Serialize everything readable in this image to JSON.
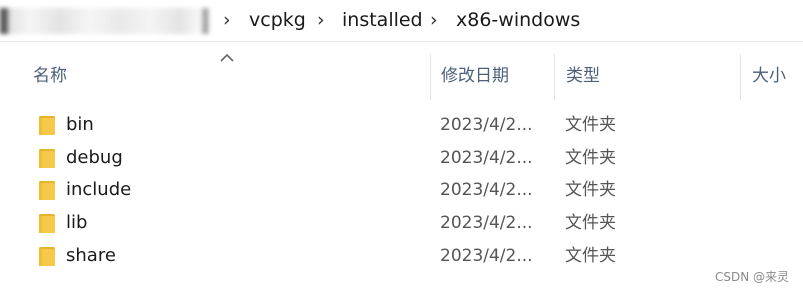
{
  "breadcrumb": {
    "items": [
      "vcpkg",
      "installed",
      "x86-windows"
    ],
    "separator": "›"
  },
  "columns": {
    "name": "名称",
    "date": "修改日期",
    "type": "类型",
    "size": "大小",
    "sort_indicator_icon": "chevron-up-icon"
  },
  "files": [
    {
      "name": "bin",
      "date": "2023/4/2...",
      "type": "文件夹",
      "icon": "folder-icon"
    },
    {
      "name": "debug",
      "date": "2023/4/2...",
      "type": "文件夹",
      "icon": "folder-icon"
    },
    {
      "name": "include",
      "date": "2023/4/2...",
      "type": "文件夹",
      "icon": "folder-icon"
    },
    {
      "name": "lib",
      "date": "2023/4/2...",
      "type": "文件夹",
      "icon": "folder-icon"
    },
    {
      "name": "share",
      "date": "2023/4/2...",
      "type": "文件夹",
      "icon": "folder-icon"
    }
  ],
  "colors": {
    "folder_body": "#f6c94a",
    "folder_tab": "#e8b32c",
    "header_text": "#4c607a"
  },
  "watermark": "CSDN @来灵"
}
